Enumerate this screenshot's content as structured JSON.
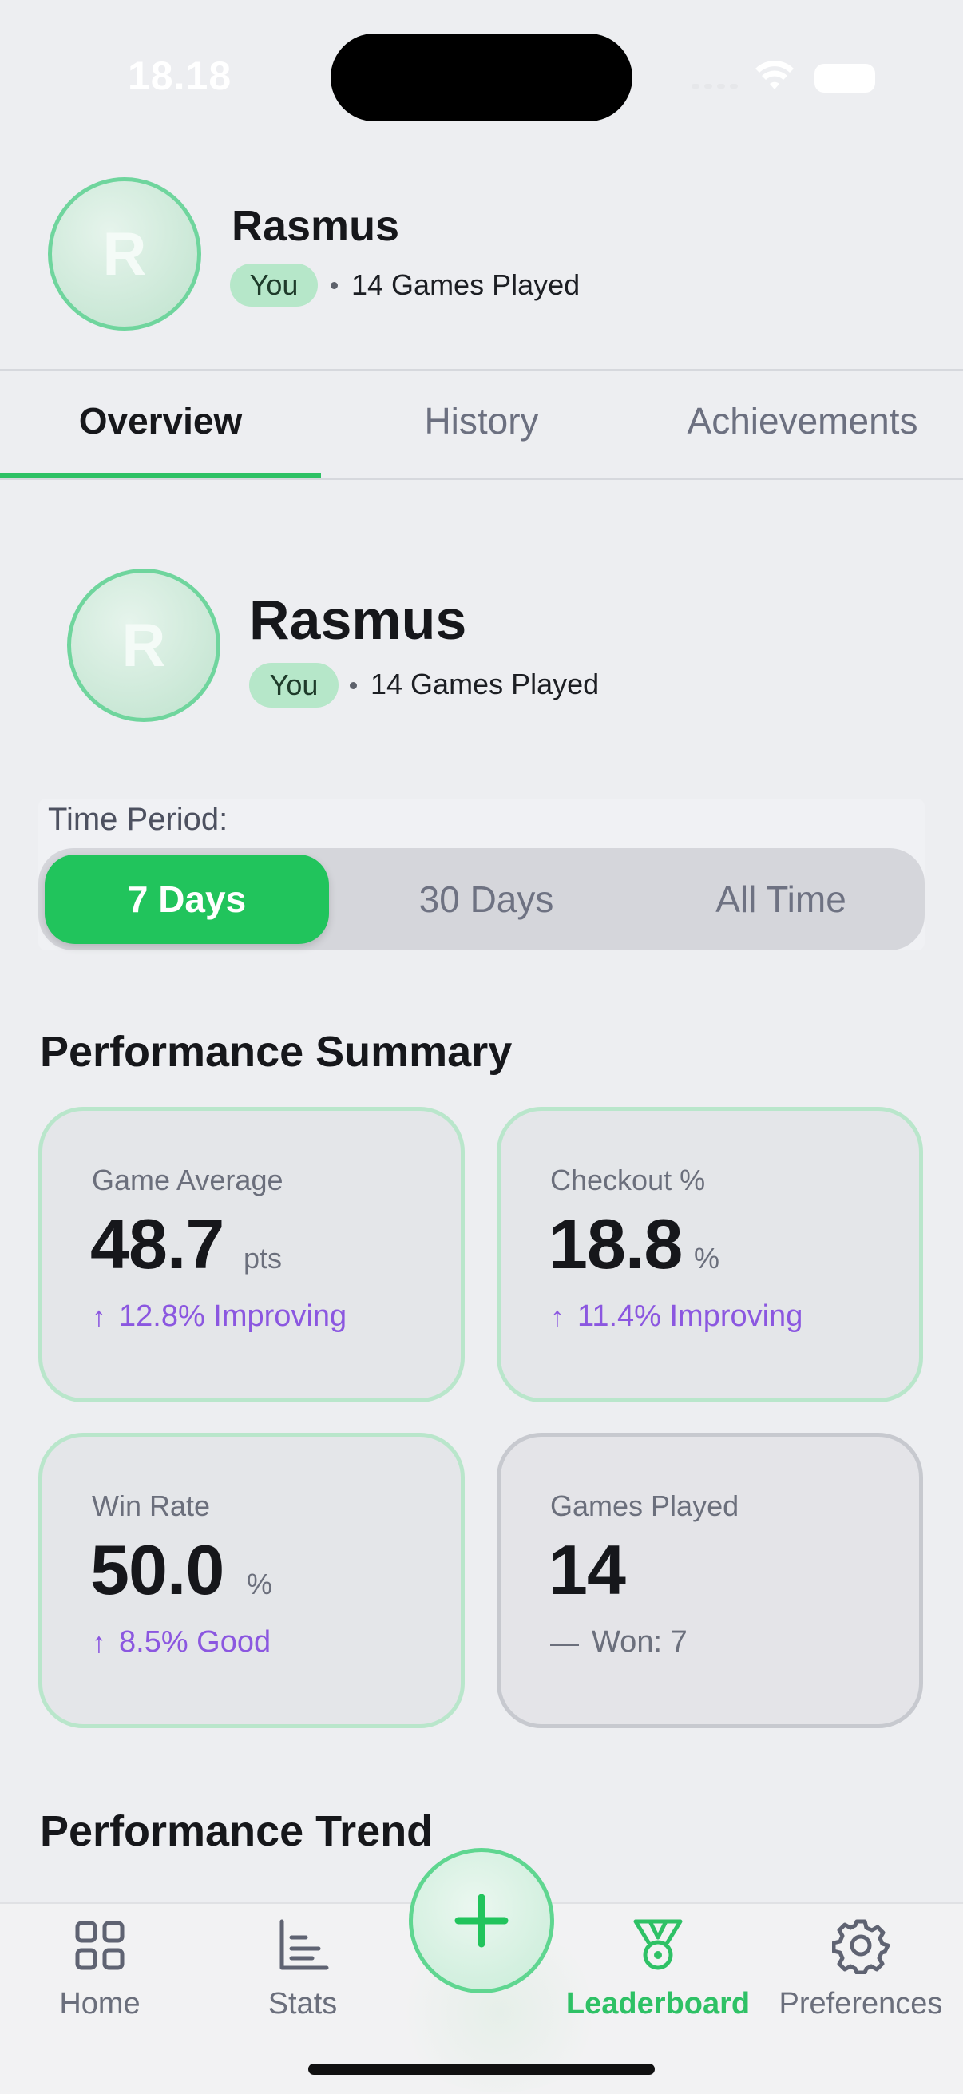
{
  "status_bar": {
    "time": "18.18"
  },
  "profile": {
    "initial": "R",
    "name": "Rasmus",
    "badge": "You",
    "games_played_text": "14 Games Played"
  },
  "tabs": [
    {
      "label": "Overview",
      "active": true
    },
    {
      "label": "History",
      "active": false
    },
    {
      "label": "Achievements",
      "active": false
    }
  ],
  "time_period": {
    "label": "Time Period:",
    "options": [
      {
        "label": "7 Days",
        "selected": true
      },
      {
        "label": "30 Days",
        "selected": false
      },
      {
        "label": "All Time",
        "selected": false
      }
    ]
  },
  "performance_summary": {
    "title": "Performance Summary",
    "cards": [
      {
        "label": "Game Average",
        "value": "48.7",
        "unit": "pts",
        "trend_icon": "arrow-up-icon",
        "trend": "12.8% Improving"
      },
      {
        "label": "Checkout %",
        "value": "18.8",
        "unit": "%",
        "trend_icon": "arrow-up-icon",
        "trend": "11.4% Improving"
      },
      {
        "label": "Win Rate",
        "value": "50.0",
        "unit": "%",
        "trend_icon": "arrow-up-icon",
        "trend": "8.5% Good"
      },
      {
        "label": "Games Played",
        "value": "14",
        "unit": "",
        "trend_icon": "dash-icon",
        "trend": "Won: 7"
      }
    ]
  },
  "performance_trend": {
    "title": "Performance Trend"
  },
  "bottom_nav": {
    "items": [
      {
        "label": "Home",
        "icon": "grid-icon",
        "active": false
      },
      {
        "label": "Stats",
        "icon": "bar-chart-icon",
        "active": false
      },
      {
        "label": "Leaderboard",
        "icon": "medal-icon",
        "active": true
      },
      {
        "label": "Preferences",
        "icon": "gear-icon",
        "active": false
      }
    ],
    "fab_icon": "plus-icon"
  },
  "colors": {
    "accent": "#21c45c",
    "trend": "#8b57e0",
    "background": "#edeef1"
  }
}
